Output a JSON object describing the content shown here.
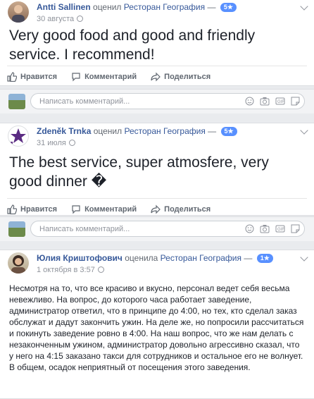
{
  "actions": {
    "like": "Нравится",
    "comment": "Комментарий",
    "share": "Поделиться"
  },
  "comment_placeholder": "Написать комментарий...",
  "posts": [
    {
      "author": "Antti Sallinen",
      "verb": "оценил",
      "page": "Ресторан География",
      "rating": "5★",
      "date": "30 августа",
      "text": "Very good food and good and friendly service. I recommend!"
    },
    {
      "author": "Zdeněk Trnka",
      "verb": "оценил",
      "page": "Ресторан География",
      "rating": "5★",
      "date": "31 июля",
      "text": "The best service, super atmosfere, very good dinner �"
    },
    {
      "author": "Юлия Криштофович",
      "verb": "оценила",
      "page": "Ресторан География",
      "rating": "1★",
      "date": "1 октября в 3:57",
      "text": "Несмотря на то, что все красиво и вкусно, персонал ведет себя весьма невежливо. На вопрос, до которого часа работает заведение, администратор ответил, что в принципе до 4:00, но тех, кто сделал заказ обслужат и дадут закончить ужин. На деле же, но попросили рассчитаться и покинуть заведение ровно в 4:00. На наш вопрос, что же нам делать с незаконченным ужином, администратор довольно агрессивно сказал, что у него на 4:15 заказано такси для сотрудников и остальное его не волнует. В общем, осадок неприятный от посещения этого заведения."
    }
  ]
}
